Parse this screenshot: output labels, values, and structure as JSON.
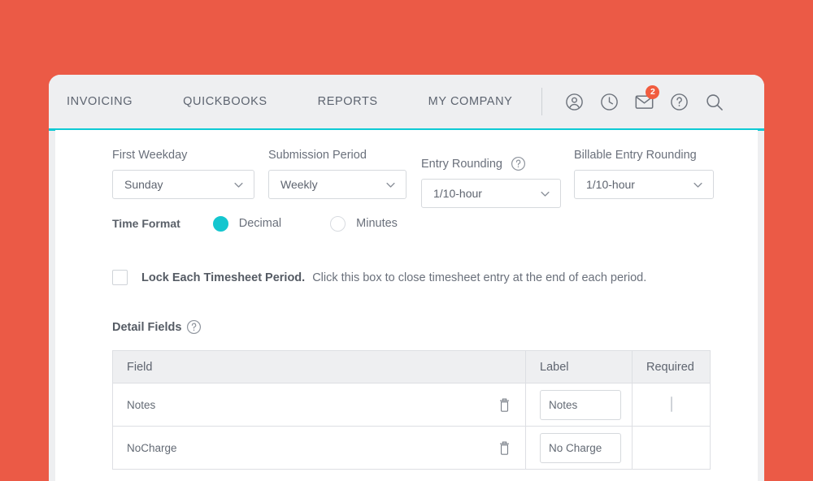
{
  "theme": {
    "page_background": "#eb5a46",
    "card_background": "#eeeff1",
    "accent_line": "#0ecad4",
    "radio_selected": "#14c6cf",
    "badge": "#f15c3f"
  },
  "nav": {
    "links": [
      {
        "label": "INVOICING",
        "name": "nav-link-invoicing"
      },
      {
        "label": "QUICKBOOKS",
        "name": "nav-link-quickbooks"
      },
      {
        "label": "REPORTS",
        "name": "nav-link-reports"
      },
      {
        "label": "MY COMPANY",
        "name": "nav-link-my-company"
      }
    ],
    "icons": [
      {
        "name": "account-icon"
      },
      {
        "name": "clock-icon"
      },
      {
        "name": "mail-icon",
        "badge": "2"
      },
      {
        "name": "help-circle-icon"
      },
      {
        "name": "search-icon"
      }
    ],
    "mail_badge_count": "2"
  },
  "settings": {
    "first_weekday": {
      "label": "First Weekday",
      "value": "Sunday"
    },
    "submission_period": {
      "label": "Submission Period",
      "value": "Weekly"
    },
    "entry_rounding": {
      "label": "Entry Rounding",
      "value": "1/10-hour",
      "has_help": true
    },
    "billable_entry_rounding": {
      "label": "Billable Entry Rounding",
      "value": "1/10-hour"
    }
  },
  "time_format": {
    "label": "Time Format",
    "options": [
      {
        "label": "Decimal",
        "selected": true
      },
      {
        "label": "Minutes",
        "selected": false
      }
    ]
  },
  "lock_period": {
    "checked": false,
    "title": "Lock Each Timesheet Period.",
    "hint": "Click this box to close timesheet entry at the end of each period."
  },
  "detail_fields": {
    "title": "Detail Fields",
    "columns": [
      "Field",
      "Label",
      "Required"
    ],
    "rows": [
      {
        "field": "Notes",
        "label_value": "Notes",
        "required": false,
        "has_required_checkbox": true
      },
      {
        "field": "NoCharge",
        "label_value": "No Charge",
        "required": false,
        "has_required_checkbox": false
      }
    ]
  }
}
